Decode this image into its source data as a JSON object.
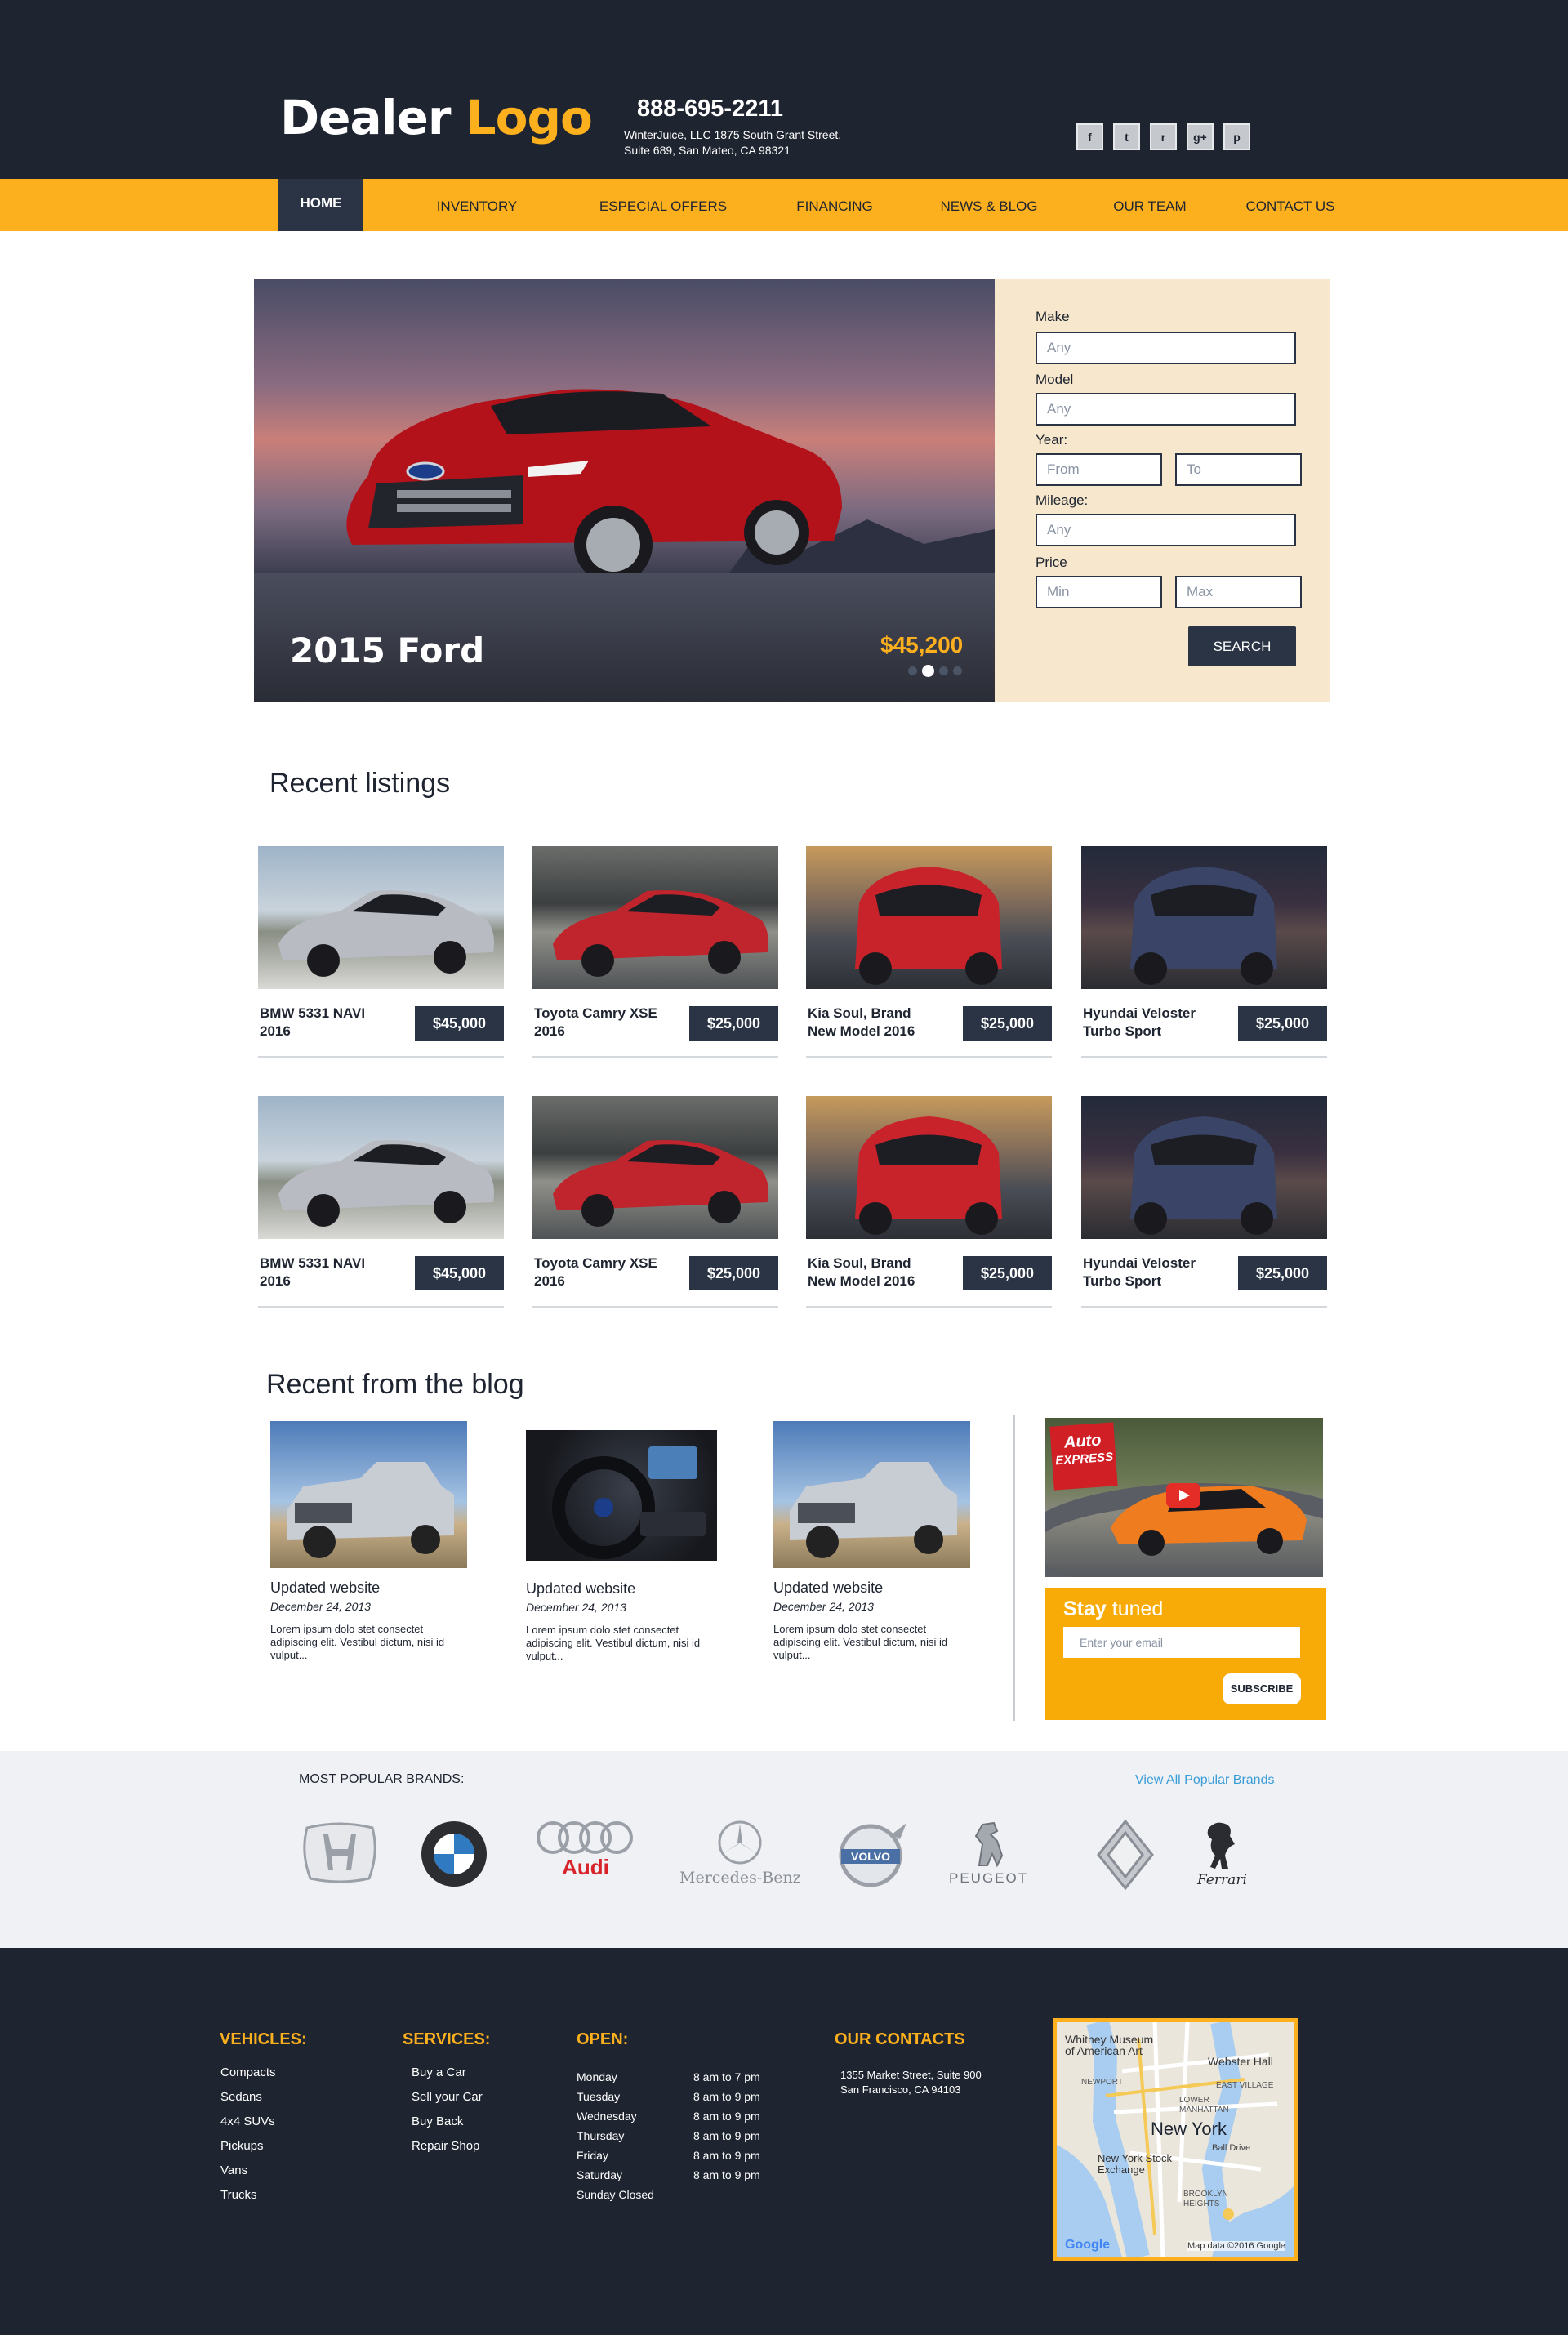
{
  "header": {
    "logo_main": "Dealer",
    "logo_accent": "Logo",
    "phone": "888-695-2211",
    "address_line1": "WinterJuice, LLC 1875 South Grant Street,",
    "address_line2": "Suite 689, San Mateo, CA 98321",
    "social": [
      {
        "icon": "facebook-icon",
        "glyph": "f"
      },
      {
        "icon": "twitter-icon",
        "glyph": "t"
      },
      {
        "icon": "rss-icon",
        "glyph": "r"
      },
      {
        "icon": "google-plus-icon",
        "glyph": "g+"
      },
      {
        "icon": "pinterest-icon",
        "glyph": "p"
      }
    ]
  },
  "nav": {
    "items": [
      {
        "label": "HOME",
        "active": true
      },
      {
        "label": "INVENTORY"
      },
      {
        "label": "ESPECIAL OFFERS"
      },
      {
        "label": "FINANCING"
      },
      {
        "label": "NEWS & BLOG"
      },
      {
        "label": "OUR TEAM"
      },
      {
        "label": "CONTACT US"
      }
    ]
  },
  "hero": {
    "title": "2015 Ford",
    "price": "$45,200",
    "slides": 4,
    "active_slide": 2
  },
  "search": {
    "make_label": "Make",
    "make_placeholder": "Any",
    "model_label": "Model",
    "model_placeholder": "Any",
    "year_label": "Year:",
    "year_from": "From",
    "year_to": "To",
    "mileage_label": "Mileage:",
    "mileage_placeholder": "Any",
    "price_label": "Price",
    "price_min": "Min",
    "price_max": "Max",
    "button": "SEARCH"
  },
  "listings": {
    "title": "Recent listings",
    "items": [
      {
        "name": "BMW 5331 NAVI 2016",
        "price": "$45,000",
        "color": "#b8bcc2"
      },
      {
        "name": "Toyota Camry XSE 2016",
        "price": "$25,000",
        "color": "#c0242c"
      },
      {
        "name": "Kia Soul, Brand New Model 2016",
        "price": "$25,000",
        "color": "#c8232b"
      },
      {
        "name": "Hyundai Veloster Turbo Sport",
        "price": "$25,000",
        "color": "#3a4466"
      },
      {
        "name": "BMW 5331 NAVI 2016",
        "price": "$45,000",
        "color": "#b8bcc2"
      },
      {
        "name": "Toyota Camry XSE 2016",
        "price": "$25,000",
        "color": "#c0242c"
      },
      {
        "name": "Kia Soul, Brand New Model 2016",
        "price": "$25,000",
        "color": "#c8232b"
      },
      {
        "name": "Hyundai Veloster Turbo Sport",
        "price": "$25,000",
        "color": "#3a4466"
      }
    ]
  },
  "blog": {
    "title": "Recent from the blog",
    "posts": [
      {
        "title": "Updated website",
        "date": "December 24, 2013",
        "text": "Lorem ipsum dolo stet consectet adipiscing elit. Vestibul dictum, nisi id vulput..."
      },
      {
        "title": "Updated website",
        "date": "December 24, 2013",
        "text": "Lorem ipsum dolo stet consectet adipiscing elit. Vestibul dictum, nisi id vulput..."
      },
      {
        "title": "Updated website",
        "date": "December 24, 2013",
        "text": "Lorem ipsum dolo stet consectet adipiscing elit. Vestibul dictum, nisi id vulput..."
      }
    ],
    "video_badge_line1": "Auto",
    "video_badge_line2": "EXPRESS"
  },
  "newsletter": {
    "title_bold": "Stay",
    "title_light": "tuned",
    "placeholder": "Enter your  email",
    "button": "SUBSCRIBE"
  },
  "brands": {
    "title": "MOST POPULAR BRANDS:",
    "link": "View All Popular Brands",
    "items": [
      {
        "name": "Honda",
        "label": ""
      },
      {
        "name": "BMW",
        "label": ""
      },
      {
        "name": "Audi",
        "label": "Audi"
      },
      {
        "name": "Mercedes-Benz",
        "label": "Mercedes-Benz"
      },
      {
        "name": "Volvo",
        "label": ""
      },
      {
        "name": "Peugeot",
        "label": "PEUGEOT"
      },
      {
        "name": "Renault",
        "label": ""
      },
      {
        "name": "Ferrari",
        "label": "Ferrari"
      }
    ]
  },
  "footer": {
    "vehicles_title": "VEHICLES:",
    "vehicles": [
      "Compacts",
      "Sedans",
      "4x4 SUVs",
      "Pickups",
      "Vans",
      "Trucks"
    ],
    "services_title": "SERVICES:",
    "services": [
      "Buy a Car",
      "Sell your Car",
      "Buy Back",
      "Repair Shop"
    ],
    "open_title": "OPEN:",
    "hours": [
      {
        "day": "Monday",
        "time": "8 am to 7 pm"
      },
      {
        "day": "Tuesday",
        "time": "8 am to 9 pm"
      },
      {
        "day": "Wednesday",
        "time": "8 am to 9 pm"
      },
      {
        "day": "Thursday",
        "time": "8 am to 9 pm"
      },
      {
        "day": "Friday",
        "time": "8 am to 9 pm"
      },
      {
        "day": "Saturday",
        "time": "8 am to 9 pm"
      },
      {
        "day": "Sunday Closed",
        "time": ""
      }
    ],
    "contacts_title": "OUR CONTACTS",
    "contact_line1": "1355 Market Street, Suite 900",
    "contact_line2": "San Francisco,  CA 94103",
    "map": {
      "city": "New York",
      "labels": [
        "Whitney Museum of American Art",
        "Webster Hall",
        "LOWER MANHATTAN",
        "EAST VILLAGE",
        "New York Stock Exchange",
        "BROOKLYN HEIGHTS",
        "NEWPORT",
        "Ball Drive"
      ],
      "attribution": "Map data ©2016 Google",
      "google": "Google"
    }
  }
}
